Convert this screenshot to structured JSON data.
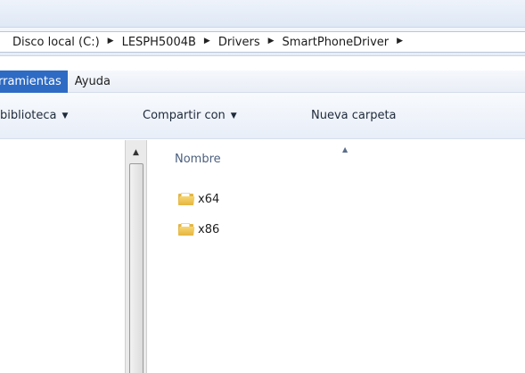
{
  "address": {
    "crumbs": [
      "Disco local (C:)",
      "LESPH5004B",
      "Drivers",
      "SmartPhoneDriver"
    ]
  },
  "menu": {
    "items": [
      "rramientas",
      "Ayuda"
    ]
  },
  "toolbar": {
    "library_label": "biblioteca",
    "share_label": "Compartir con",
    "new_folder_label": "Nueva carpeta"
  },
  "content": {
    "column_header": "Nombre",
    "files": [
      {
        "name": "x64",
        "icon": "folder-icon"
      },
      {
        "name": "x86",
        "icon": "folder-icon"
      }
    ]
  },
  "colors": {
    "menu_active": "#2e6bc4",
    "folder": "#e2b547"
  }
}
